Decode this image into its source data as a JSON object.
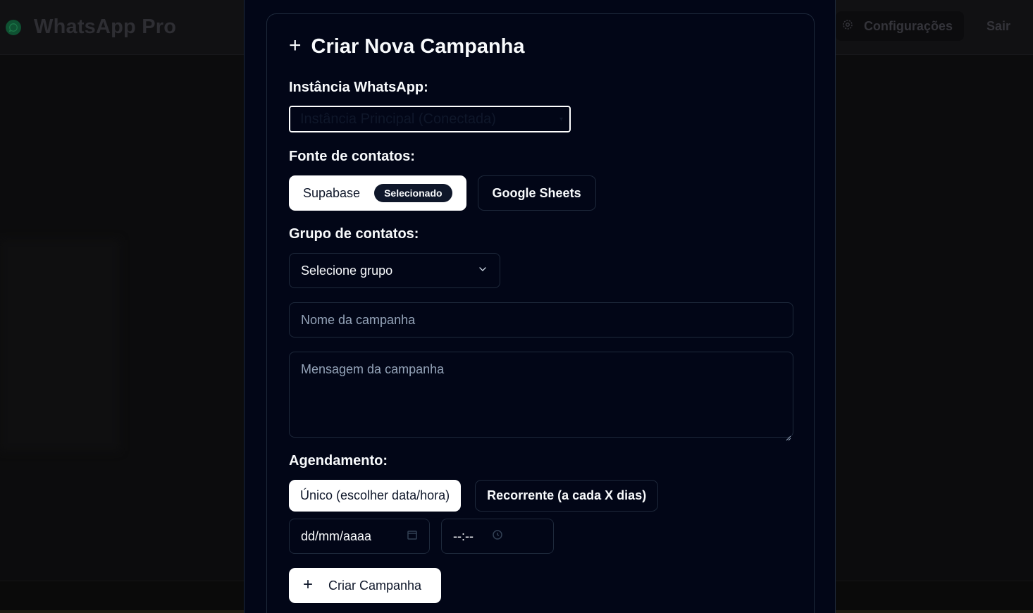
{
  "app": {
    "title": "WhatsApp Pro",
    "settings_label": "Configurações",
    "logout_label": "Sair"
  },
  "modal": {
    "title": "Criar Nova Campanha",
    "instance": {
      "label": "Instância WhatsApp:",
      "selected": "Instância Principal (Conectada)"
    },
    "source": {
      "label": "Fonte de contatos:",
      "options": [
        {
          "label": "Supabase",
          "badge": "Selecionado",
          "active": true
        },
        {
          "label": "Google Sheets",
          "active": false
        }
      ]
    },
    "group": {
      "label": "Grupo de contatos:",
      "placeholder": "Selecione grupo"
    },
    "campaign_name": {
      "placeholder": "Nome da campanha"
    },
    "campaign_message": {
      "placeholder": "Mensagem da campanha"
    },
    "schedule": {
      "label": "Agendamento:",
      "options": [
        {
          "label": "Único (escolher data/hora)",
          "active": true
        },
        {
          "label": "Recorrente (a cada X dias)",
          "active": false
        }
      ],
      "date_placeholder": "dd/mm/aaaa",
      "time_placeholder": "--:--"
    },
    "submit_label": "Criar Campanha"
  },
  "colors": {
    "modal_bg": "#020617",
    "border": "#1e293b",
    "primary_button": "#ffffff",
    "badge_bg": "#0f172a",
    "brand_green": "#0f5132"
  }
}
